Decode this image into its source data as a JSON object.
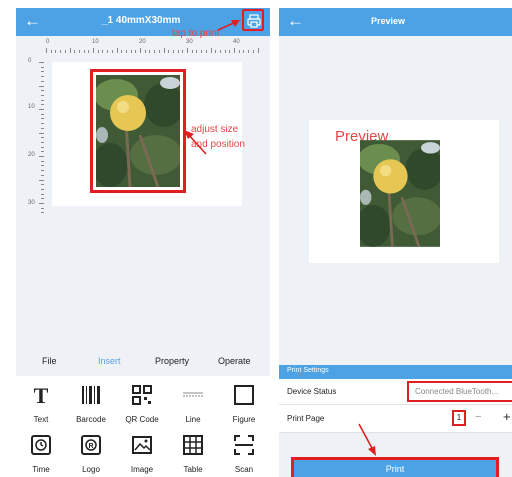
{
  "left": {
    "header": {
      "back_icon": "back-arrow-icon",
      "title": "_1 40mmX30mm",
      "print_icon": "printer-icon"
    },
    "annotations": {
      "tap_to_print": "tap to print",
      "adjust_line1": "adjust size",
      "adjust_line2": "and position"
    },
    "ruler_top": [
      "0",
      "10",
      "20",
      "30",
      "40"
    ],
    "ruler_left": [
      "0",
      "10",
      "20",
      "30"
    ],
    "tabs": [
      "File",
      "Insert",
      "Property",
      "Operate"
    ],
    "active_tab": "Insert",
    "tools": [
      {
        "label": "Text",
        "icon": "text-icon"
      },
      {
        "label": "Barcode",
        "icon": "barcode-icon"
      },
      {
        "label": "QR Code",
        "icon": "qr-code-icon"
      },
      {
        "label": "Line",
        "icon": "line-icon"
      },
      {
        "label": "Figure",
        "icon": "figure-icon"
      },
      {
        "label": "Time",
        "icon": "clock-icon"
      },
      {
        "label": "Logo",
        "icon": "logo-icon"
      },
      {
        "label": "Image",
        "icon": "image-icon"
      },
      {
        "label": "Table",
        "icon": "table-icon"
      },
      {
        "label": "Scan",
        "icon": "scan-icon"
      }
    ]
  },
  "right": {
    "header": {
      "back_icon": "back-arrow-icon",
      "title": "Preview"
    },
    "preview_label": "Preview",
    "settings": {
      "title": "Print Settings",
      "device_status_label": "Device Status",
      "device_status_value": "Connected BlueTooth...",
      "print_page_label": "Print Page",
      "print_page_value": "1",
      "minus": "−",
      "plus": "+"
    },
    "print_button": "Print"
  },
  "colors": {
    "accent": "#4da2e6",
    "highlight": "#e02020",
    "annotation": "#e64545",
    "background": "#eef1f6"
  }
}
